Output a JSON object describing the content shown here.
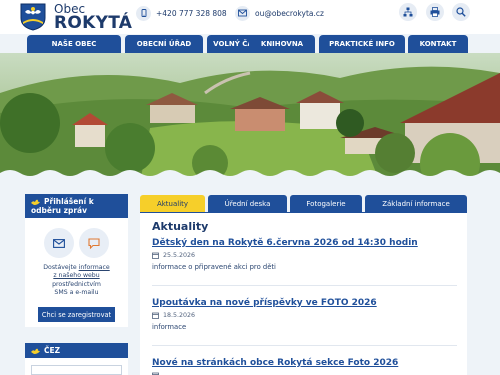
{
  "header": {
    "title_top": "Obec",
    "title_main": "ROKYTÁ",
    "phone": "+420 777 328 808",
    "email": "ou@obecrokyta.cz"
  },
  "nav": {
    "items": [
      {
        "label": "NAŠE OBEC"
      },
      {
        "label": "OBECNÍ ÚŘAD"
      },
      {
        "label": "VOLNÝ ČAS"
      },
      {
        "label": "KNIHOVNA"
      },
      {
        "label": "PRAKTICKÉ INFO"
      },
      {
        "label": "KONTAKT"
      }
    ]
  },
  "sidebar": {
    "subscribe": {
      "heading": "Přihlášení k odběru zpráv",
      "text_line1": "Dostávejte",
      "text_link1": "informace",
      "text_link2": "z našeho webu",
      "text_line3": "prostřednictvím",
      "text_line4": "SMS a e-mailu",
      "register_label": "Chci se zaregistrovat"
    },
    "cez": {
      "heading": "ČEZ"
    }
  },
  "tabs": [
    {
      "label": "Aktuality",
      "active": true
    },
    {
      "label": "Úřední deska",
      "active": false
    },
    {
      "label": "Fotogalerie",
      "active": false
    },
    {
      "label": "Základní informace",
      "active": false
    }
  ],
  "content": {
    "section_title": "Aktuality",
    "news": [
      {
        "title": "Dětský den na Rokytě 6.června 2026 od 14:30 hodin",
        "date": "25.5.2026",
        "desc": "informace o připravené akci pro děti"
      },
      {
        "title": "Upoutávka na nové příspěvky ve FOTO 2026",
        "date": "18.5.2026",
        "desc": "informace"
      },
      {
        "title": "Nové na stránkách obce Rokytá sekce Foto 2026",
        "date": "",
        "desc": ""
      }
    ]
  },
  "colors": {
    "primary": "#1f4f9a",
    "accent": "#f6cf2a",
    "text": "#1d3a6b",
    "background": "#eef3f8"
  }
}
